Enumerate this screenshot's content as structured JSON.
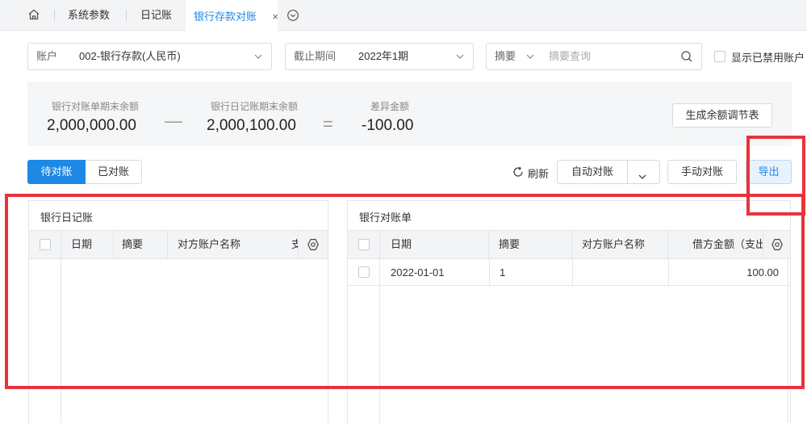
{
  "tabs": {
    "items": [
      {
        "label": "系统参数"
      },
      {
        "label": "日记账"
      },
      {
        "label": "银行存款对账"
      }
    ],
    "close_glyph": "×"
  },
  "filters": {
    "account": {
      "label": "账户",
      "value": "002-银行存款(人民币)"
    },
    "period": {
      "label": "截止期间",
      "value": "2022年1期"
    },
    "summary": {
      "label": "摘要",
      "placeholder": "摘要查询"
    },
    "show_disabled": {
      "label": "显示已禁用账户"
    }
  },
  "summary_bar": {
    "bank_statement_label": "银行对账单期末余额",
    "bank_statement_value": "2,000,000.00",
    "minus": "—",
    "journal_label": "银行日记账期末余额",
    "journal_value": "2,000,100.00",
    "equals": "=",
    "diff_label": "差异金额",
    "diff_value": "-100.00",
    "generate_button": "生成余额调节表"
  },
  "toolbar": {
    "pending": "待对账",
    "done": "已对账",
    "refresh": "刷新",
    "auto_match": "自动对账",
    "manual_match": "手动对账",
    "export": "导出"
  },
  "journal_panel": {
    "title": "银行日记账",
    "columns": [
      "日期",
      "摘要",
      "对方账户名称",
      "支"
    ]
  },
  "statement_panel": {
    "title": "银行对账单",
    "columns": [
      "日期",
      "摘要",
      "对方账户名称",
      "借方金额（支出）"
    ],
    "rows": [
      {
        "date": "2022-01-01",
        "summary": "1",
        "counterparty": "",
        "debit": "100.00"
      }
    ]
  },
  "colors": {
    "accent": "#1e88e5",
    "highlight": "#e8333a"
  },
  "icons": [
    "home-icon",
    "chevron-down-icon",
    "search-icon",
    "refresh-icon",
    "settings-icon",
    "close-icon"
  ]
}
